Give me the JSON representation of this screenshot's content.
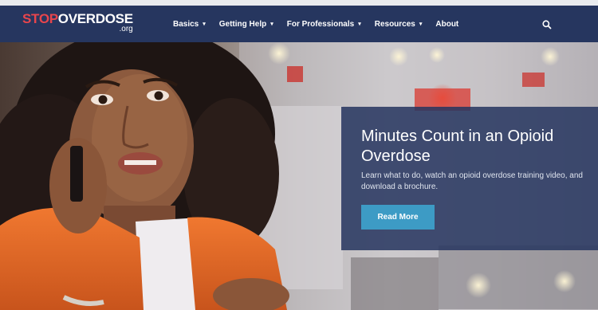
{
  "header": {
    "logo": {
      "part1": "STOP",
      "part2": "OVERDOSE",
      "tld": ".org"
    },
    "nav": [
      {
        "label": "Basics",
        "has_dropdown": true
      },
      {
        "label": "Getting Help",
        "has_dropdown": true
      },
      {
        "label": "For Professionals",
        "has_dropdown": true
      },
      {
        "label": "Resources",
        "has_dropdown": true
      },
      {
        "label": "About",
        "has_dropdown": false
      }
    ],
    "caret": "▾",
    "search_icon": "search-icon"
  },
  "hero": {
    "title": "Minutes Count in an Opioid Overdose",
    "text": "Learn what to do, watch an opioid overdose training video, and download a brochure.",
    "button": "Read More"
  },
  "colors": {
    "header_bg": "#26365f",
    "logo_accent": "#e8454c",
    "panel_bg": "#26365f",
    "button_bg": "#3d9bc5"
  }
}
